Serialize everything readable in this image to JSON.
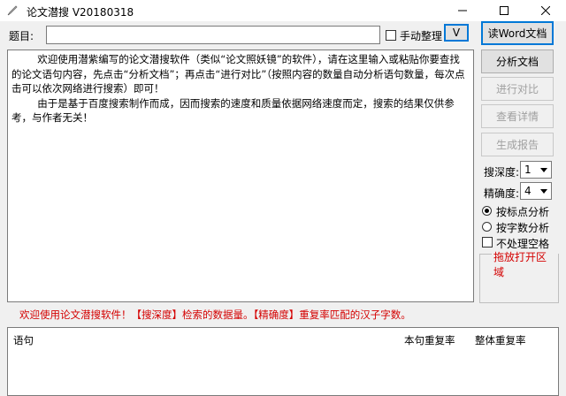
{
  "window": {
    "title": "论文潜搜 V20180318"
  },
  "topic": {
    "label": "题目:",
    "value": "",
    "manual_label": "手动整理",
    "manual_checked": false,
    "v_button": "V"
  },
  "main_text": "        欢迎使用潜紫编写的论文潜搜软件（类似“论文照妖镜”的软件），请在这里输入或粘贴你要查找的论文语句内容，先点击“分析文档”；再点击“进行对比”（按照内容的数量自动分析语句数量，每次点击可以依次网络进行搜索）即可！\n        由于是基于百度搜索制作而成，因而搜索的速度和质量依据网络速度而定，搜索的结果仅供参考，与作者无关！",
  "buttons": {
    "read_word": "读Word文档",
    "analyze": "分析文档",
    "compare": "进行对比",
    "details": "查看详情",
    "report": "生成报告"
  },
  "options": {
    "depth_label": "搜深度:",
    "depth_value": "1",
    "precision_label": "精确度:",
    "precision_value": "4",
    "radio_punct": "按标点分析",
    "radio_chars": "按字数分析",
    "radio_selected": "punct",
    "no_space_label": "不处理空格",
    "no_space_checked": false,
    "drop_zone_label": "拖放打开区域"
  },
  "hint": "欢迎使用论文潜搜软件！【搜深度】检索的数据量。【精确度】重复率匹配的汉子字数。",
  "results": {
    "columns": [
      "语句",
      "本句重复率",
      "整体重复率"
    ],
    "rows": []
  },
  "colors": {
    "accent": "#0078d7",
    "hint": "#d40000",
    "drop_zone": "#d40000"
  },
  "icons": {
    "app": "pen-icon",
    "minimize": "minimize-icon",
    "maximize": "maximize-icon",
    "close": "close-icon"
  }
}
